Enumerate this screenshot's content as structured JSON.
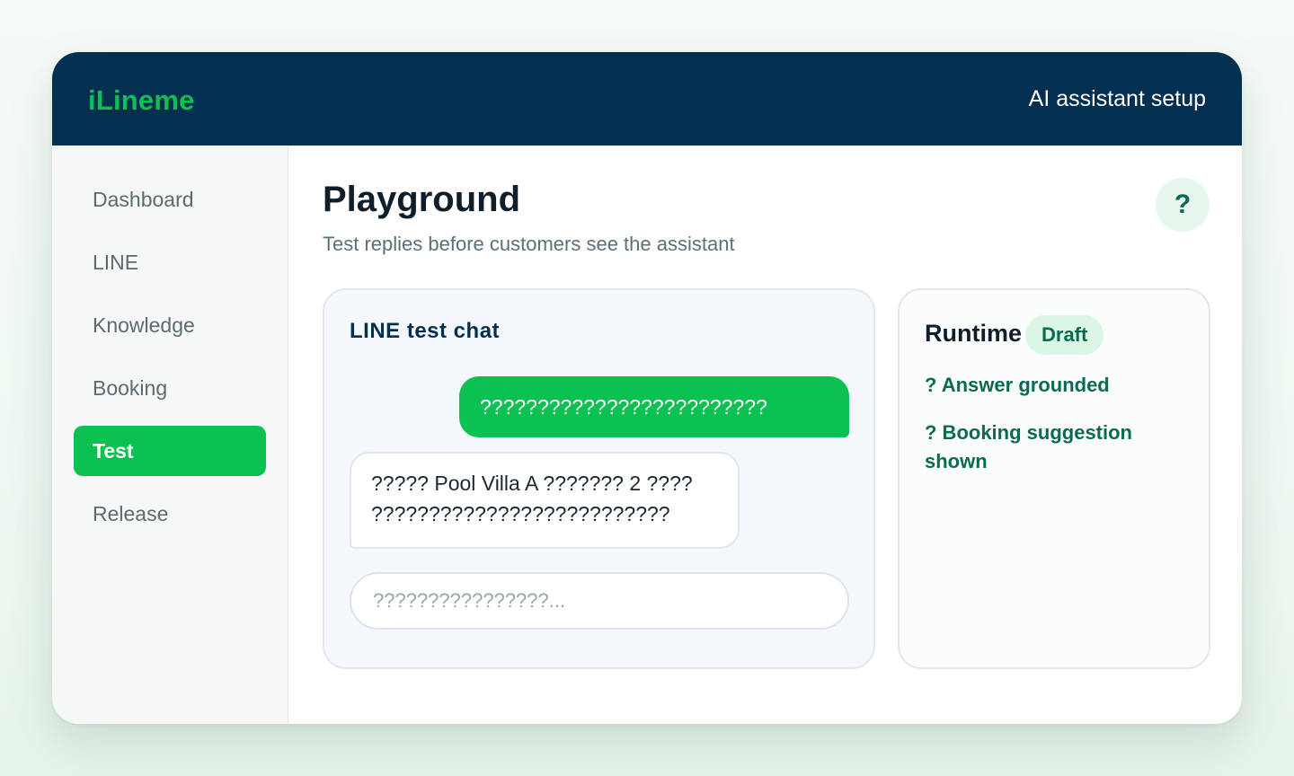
{
  "header": {
    "brand": "iLineme",
    "title": "AI assistant setup"
  },
  "sidebar": {
    "items": [
      {
        "label": "Dashboard",
        "active": false
      },
      {
        "label": "LINE",
        "active": false
      },
      {
        "label": "Knowledge",
        "active": false
      },
      {
        "label": "Booking",
        "active": false
      },
      {
        "label": "Test",
        "active": true
      },
      {
        "label": "Release",
        "active": false
      }
    ]
  },
  "main": {
    "title": "Playground",
    "subtitle": "Test replies before customers see the assistant",
    "help_label": "?"
  },
  "chat": {
    "title": "LINE test chat",
    "outgoing_message": "?????????????????????????",
    "incoming_message_line1": "????? Pool Villa A ??????? 2 ????",
    "incoming_message_line2": "??????????????????????????",
    "input_placeholder": "????????????????..."
  },
  "runtime": {
    "title": "Runtime",
    "status": "Draft",
    "checks": [
      "? Answer grounded",
      "? Booking suggestion shown"
    ]
  },
  "colors": {
    "header_bg": "#032f50",
    "brand_green": "#0ac152",
    "accent_dark_green": "#0b6b52",
    "badge_bg": "#dcf6e5"
  }
}
